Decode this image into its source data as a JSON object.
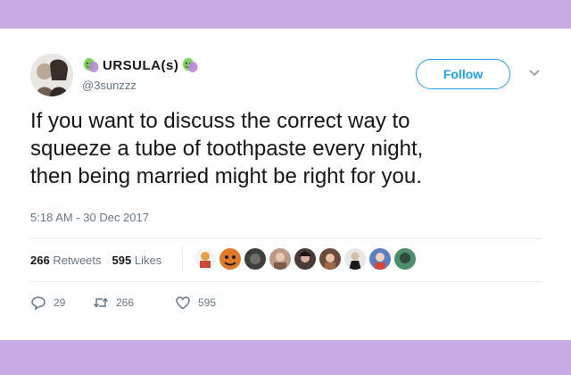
{
  "tweet": {
    "display_name": "URSULA(s)",
    "handle": "@3sunzzz",
    "follow_label": "Follow",
    "text_lines": [
      "If you want to discuss the correct way to",
      "squeeze a tube of toothpaste every night,",
      "then being married might be right for you."
    ],
    "timestamp": "5:18 AM - 30 Dec 2017",
    "stats": {
      "retweets_count": "266",
      "retweets_label": "Retweets",
      "likes_count": "595",
      "likes_label": "Likes"
    },
    "actions": {
      "reply_count": "29",
      "retweet_count": "266",
      "like_count": "595"
    }
  },
  "colors": {
    "accent": "#1da1f2",
    "band": "#c9a9e3",
    "muted": "#657786",
    "mask_green": "#7cd35a",
    "mask_purple": "#b98ad8"
  },
  "icons": {
    "reply": "reply-icon",
    "retweet": "retweet-icon",
    "like": "heart-icon",
    "caret": "chevron-down-icon",
    "emoji": "performing-arts-masks-icon"
  },
  "likers": [
    "liker-avatar-1",
    "liker-avatar-2",
    "liker-avatar-3",
    "liker-avatar-4",
    "liker-avatar-5",
    "liker-avatar-6",
    "liker-avatar-7",
    "liker-avatar-8",
    "liker-avatar-9",
    "liker-avatar-10"
  ]
}
